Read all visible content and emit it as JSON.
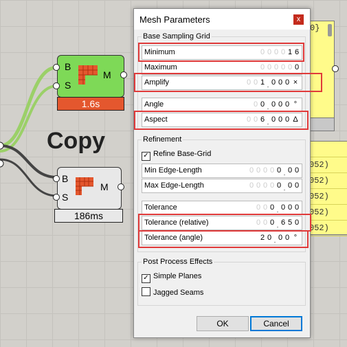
{
  "canvas": {
    "copy_label": "Copy",
    "component_top": {
      "in1": "B",
      "in2": "S",
      "out": "M",
      "time": "1.6s"
    },
    "component_bottom": {
      "in1": "B",
      "in2": "S",
      "out": "M",
      "time": "186ms"
    },
    "yellow_top_text": "0}",
    "yellow_lines": [
      "052)",
      "052)",
      "052)",
      "052)",
      "052)"
    ]
  },
  "dialog": {
    "title": "Mesh Parameters",
    "close_label": "x",
    "base_group": "Base Sampling Grid",
    "minimum": {
      "label": "Minimum",
      "digits": [
        "0",
        "0",
        "0",
        "0",
        "1",
        "6"
      ]
    },
    "maximum": {
      "label": "Maximum",
      "digits": [
        "0",
        "0",
        "0",
        "0",
        "0",
        "0"
      ]
    },
    "amplify": {
      "label": "Amplify",
      "digits": [
        "0",
        "0",
        "1",
        ".",
        "0",
        "0",
        "0"
      ],
      "unit": "×"
    },
    "angle": {
      "label": "Angle",
      "digits": [
        "0",
        "0",
        ".",
        "0",
        "0",
        "0"
      ],
      "unit": "°"
    },
    "aspect": {
      "label": "Aspect",
      "digits": [
        "0",
        "0",
        "6",
        ".",
        "0",
        "0",
        "0"
      ],
      "unit": "Δ"
    },
    "refinement_group": "Refinement",
    "refine_checkbox": "Refine Base-Grid",
    "min_edge": {
      "label": "Min Edge-Length",
      "digits": [
        "0",
        "0",
        "0",
        "0",
        "0",
        ".",
        "0",
        "0"
      ]
    },
    "max_edge": {
      "label": "Max Edge-Length",
      "digits": [
        "0",
        "0",
        "0",
        "0",
        "0",
        ".",
        "0",
        "0"
      ]
    },
    "tolerance": {
      "label": "Tolerance",
      "digits": [
        "0",
        "0",
        "0",
        ".",
        "0",
        "0",
        "0"
      ]
    },
    "tolerance_relative": {
      "label": "Tolerance (relative)",
      "digits": [
        "0",
        "0",
        "0",
        ".",
        "6",
        "5",
        "0"
      ]
    },
    "tolerance_angle": {
      "label": "Tolerance (angle)",
      "digits": [
        "2",
        "0",
        ".",
        "0",
        "0"
      ],
      "unit": "°"
    },
    "post_group": "Post Process Effects",
    "simple_planes": "Simple Planes",
    "jagged_seams": "Jagged Seams",
    "ok_label": "OK",
    "cancel_label": "Cancel"
  },
  "colors": {
    "highlight": "#e03a3a",
    "component_green": "#7ed957",
    "time_red": "#e4572e",
    "panel_yellow": "#fffb8a"
  }
}
